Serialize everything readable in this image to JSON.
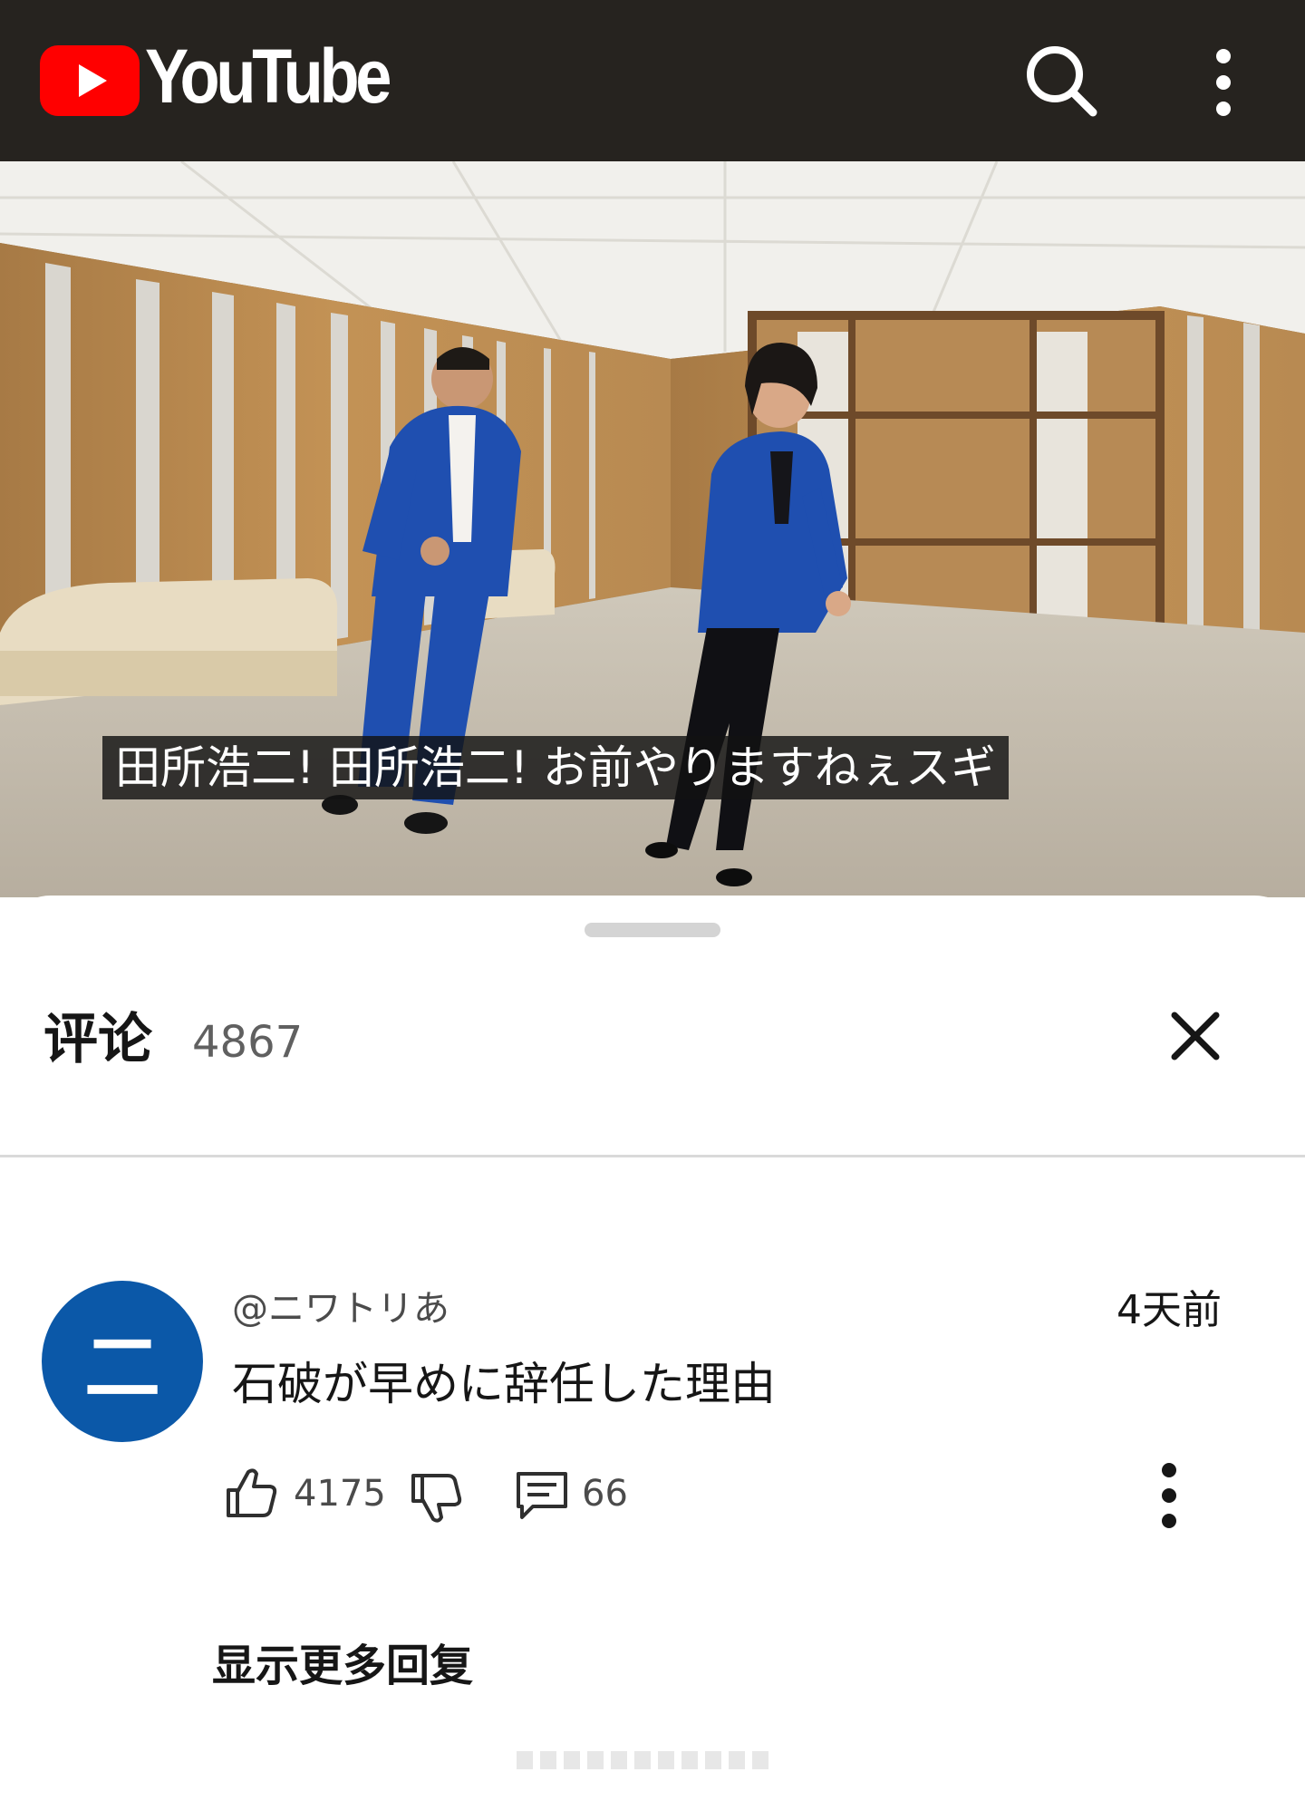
{
  "app": {
    "name": "YouTube"
  },
  "header": {
    "search_icon": "search-icon",
    "more_icon": "more-vertical-icon"
  },
  "video": {
    "caption": "田所浩二! 田所浩二! お前やりますねぇスギ"
  },
  "comments": {
    "title": "评论",
    "count": "4867",
    "close_icon": "close-icon",
    "items": [
      {
        "avatar_letter": "二",
        "author": "@ニワトリあ",
        "time": "4天前",
        "text": "石破が早めに辞任した理由",
        "likes": "4175",
        "replies": "66"
      }
    ],
    "show_more_label": "显示更多回复"
  },
  "colors": {
    "youtube_red": "#ff0000",
    "topbar": "#26231f",
    "avatar": "#0b58a8"
  }
}
